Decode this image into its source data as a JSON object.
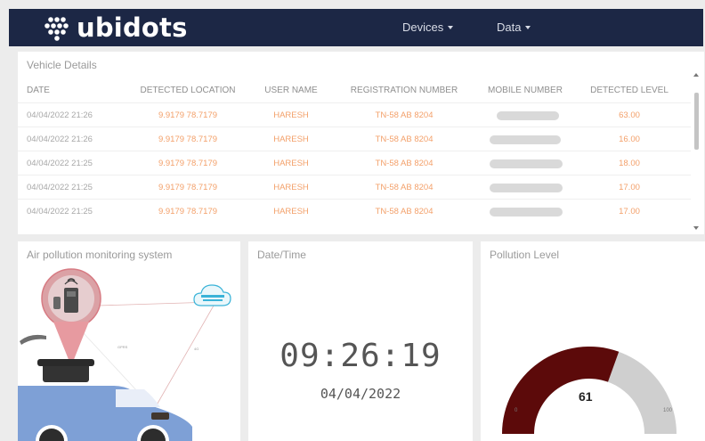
{
  "brand": {
    "name": "ubidots"
  },
  "nav": [
    {
      "label": "Devices"
    },
    {
      "label": "Data"
    }
  ],
  "vehicle_details": {
    "title": "Vehicle Details",
    "columns": [
      "DATE",
      "DETECTED LOCATION",
      "USER NAME",
      "REGISTRATION NUMBER",
      "MOBILE NUMBER",
      "DETECTED LEVEL"
    ],
    "rows": [
      {
        "date": "04/04/2022 21:26",
        "location": "9.9179 78.7179",
        "user": "HARESH",
        "registration": "TN-58 AB 8204",
        "mobile": "",
        "level": "63.00"
      },
      {
        "date": "04/04/2022 21:26",
        "location": "9.9179 78.7179",
        "user": "HARESH",
        "registration": "TN-58 AB 8204",
        "mobile": "",
        "level": "16.00"
      },
      {
        "date": "04/04/2022 21:25",
        "location": "9.9179 78.7179",
        "user": "HARESH",
        "registration": "TN-58 AB 8204",
        "mobile": "",
        "level": "18.00"
      },
      {
        "date": "04/04/2022 21:25",
        "location": "9.9179 78.7179",
        "user": "HARESH",
        "registration": "TN-58 AB 8204",
        "mobile": "",
        "level": "17.00"
      },
      {
        "date": "04/04/2022 21:25",
        "location": "9.9179 78.7179",
        "user": "HARESH",
        "registration": "TN-58 AB 8204",
        "mobile": "",
        "level": "17.00"
      }
    ]
  },
  "air_pollution": {
    "title": "Air pollution monitoring system"
  },
  "datetime": {
    "title": "Date/Time",
    "time": "09:26:19",
    "date": "04/04/2022"
  },
  "pollution_level": {
    "title": "Pollution Level",
    "value": 61,
    "min": "0",
    "max": "100",
    "colors": {
      "fill": "#5c0a0a",
      "track": "#cfcfcf"
    }
  },
  "theme": {
    "topbar": "#1c2745",
    "accent_text": "#f3a06a"
  }
}
